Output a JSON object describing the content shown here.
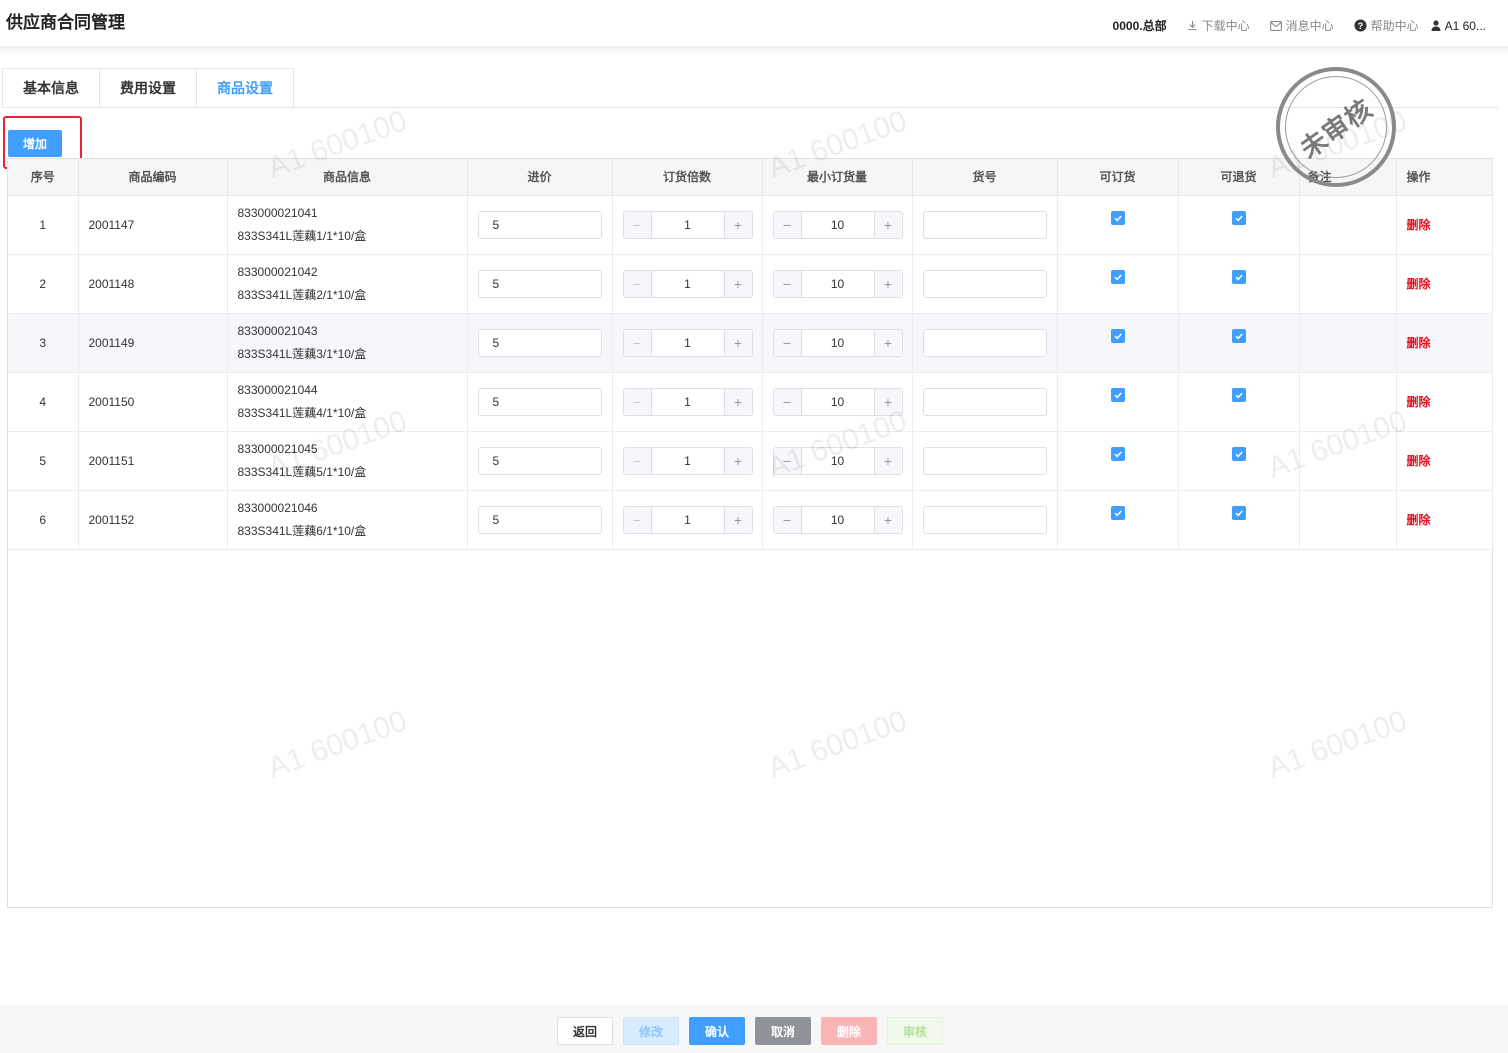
{
  "header": {
    "title": "供应商合同管理",
    "org": "0000.总部",
    "download": "下载中心",
    "message": "消息中心",
    "help": "帮助中心",
    "user": "A1 60..."
  },
  "tabs": [
    "基本信息",
    "费用设置",
    "商品设置"
  ],
  "add_label": "增加",
  "columns": [
    "序号",
    "商品编码",
    "商品信息",
    "进价",
    "订货倍数",
    "最小订货量",
    "货号",
    "可订货",
    "可退货",
    "备注",
    "操作"
  ],
  "rows": [
    {
      "no": "1",
      "code": "2001147",
      "barcode": "833000021041",
      "name": "833S341L莲藕1/1*10/盒",
      "price": "5",
      "multiple": "1",
      "min_qty": "10",
      "item_no": "",
      "can_order": true,
      "can_return": true,
      "remark": "",
      "action": "删除"
    },
    {
      "no": "2",
      "code": "2001148",
      "barcode": "833000021042",
      "name": "833S341L莲藕2/1*10/盒",
      "price": "5",
      "multiple": "1",
      "min_qty": "10",
      "item_no": "",
      "can_order": true,
      "can_return": true,
      "remark": "",
      "action": "删除"
    },
    {
      "no": "3",
      "code": "2001149",
      "barcode": "833000021043",
      "name": "833S341L莲藕3/1*10/盒",
      "price": "5",
      "multiple": "1",
      "min_qty": "10",
      "item_no": "",
      "can_order": true,
      "can_return": true,
      "remark": "",
      "action": "删除"
    },
    {
      "no": "4",
      "code": "2001150",
      "barcode": "833000021044",
      "name": "833S341L莲藕4/1*10/盒",
      "price": "5",
      "multiple": "1",
      "min_qty": "10",
      "item_no": "",
      "can_order": true,
      "can_return": true,
      "remark": "",
      "action": "删除"
    },
    {
      "no": "5",
      "code": "2001151",
      "barcode": "833000021045",
      "name": "833S341L莲藕5/1*10/盒",
      "price": "5",
      "multiple": "1",
      "min_qty": "10",
      "item_no": "",
      "can_order": true,
      "can_return": true,
      "remark": "",
      "action": "删除"
    },
    {
      "no": "6",
      "code": "2001152",
      "barcode": "833000021046",
      "name": "833S341L莲藕6/1*10/盒",
      "price": "5",
      "multiple": "1",
      "min_qty": "10",
      "item_no": "",
      "can_order": true,
      "can_return": true,
      "remark": "",
      "action": "删除"
    }
  ],
  "stamp": "未审核",
  "watermark": "A1 600100",
  "footer": {
    "back": "返回",
    "edit": "修改",
    "confirm": "确认",
    "cancel": "取消",
    "delete": "删除",
    "audit": "审核"
  },
  "colors": {
    "accent": "#409eff",
    "danger": "#e4101f"
  }
}
